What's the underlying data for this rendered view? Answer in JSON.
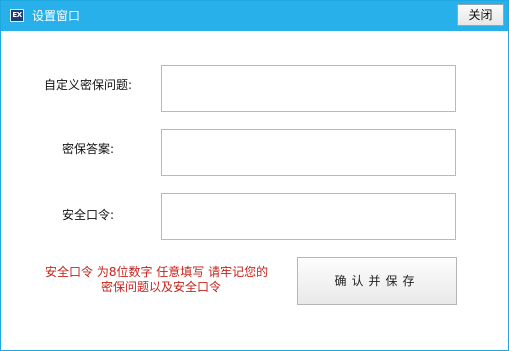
{
  "window": {
    "title": "设置窗口",
    "close_label": "关闭",
    "icon": "app-logo-icon"
  },
  "form": {
    "question_label": "自定义密保问题:",
    "question_value": "",
    "answer_label": "密保答案:",
    "answer_value": "",
    "password_label": "安全口令:",
    "password_value": ""
  },
  "notice": {
    "line1": "安全口令 为8位数字 任意填写 请牢记您的",
    "line2": "密保问题以及安全口令"
  },
  "confirm_label": "确认并保存",
  "colors": {
    "titlebar": "#27b0ea",
    "notice_text": "#c8211b"
  }
}
